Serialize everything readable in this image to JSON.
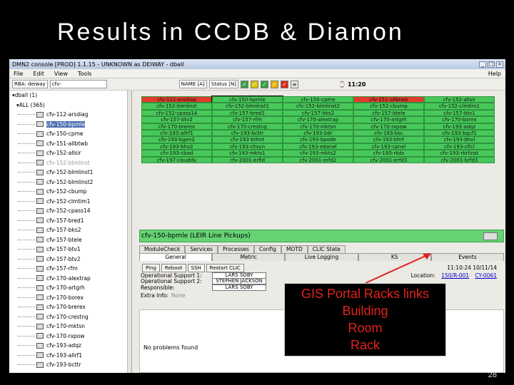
{
  "slide": {
    "title": "Results in CCDB & Diamon",
    "page_number": "28"
  },
  "window": {
    "title": "DMN2 console [PROD] 1.1.15 - UNKNOWN as DEIWAY - dball",
    "menu": [
      "File",
      "Edit",
      "View",
      "Tools"
    ],
    "help": "Help",
    "toolbar": {
      "rba_label": "RBA: deiway",
      "filter_value": "cfv-",
      "name_field": "NAME [A]",
      "status_field": "Status [N]",
      "time": "11:20"
    }
  },
  "tree": {
    "root": "dball (1)",
    "group": "ALL (365)",
    "selected_index": 1,
    "items": [
      {
        "label": "cfv-112-arsdiag",
        "dim": false
      },
      {
        "label": "cfv-150-bpmle",
        "dim": false
      },
      {
        "label": "cfv-150-cpme",
        "dim": false
      },
      {
        "label": "cfv-151-allbtwb",
        "dim": false
      },
      {
        "label": "cfv-152-allsir",
        "dim": false
      },
      {
        "label": "cfv-152-blmlinst",
        "dim": true
      },
      {
        "label": "cfv-152-blmlinst1",
        "dim": false
      },
      {
        "label": "cfv-152-blmlinst2",
        "dim": false
      },
      {
        "label": "cfv-152-cbump",
        "dim": false
      },
      {
        "label": "cfv-152-clmtim1",
        "dim": false
      },
      {
        "label": "cfv-152-cpass14",
        "dim": false
      },
      {
        "label": "cfv-157-bred1",
        "dim": false
      },
      {
        "label": "cfv-157-bks2",
        "dim": false
      },
      {
        "label": "cfv-157-btele",
        "dim": false
      },
      {
        "label": "cfv-157-btv1",
        "dim": false
      },
      {
        "label": "cfv-157-btv2",
        "dim": false
      },
      {
        "label": "cfv-157-rfm",
        "dim": false
      },
      {
        "label": "cfv-170-alextrap",
        "dim": false
      },
      {
        "label": "cfv-170-artgrh",
        "dim": false
      },
      {
        "label": "cfv-170-borex",
        "dim": false
      },
      {
        "label": "cfv-170-brerex",
        "dim": false
      },
      {
        "label": "cfv-170-crestng",
        "dim": false
      },
      {
        "label": "cfv-170-mktsn",
        "dim": false
      },
      {
        "label": "cfv-170-rxpow",
        "dim": false
      },
      {
        "label": "cfv-193-adqz",
        "dim": false
      },
      {
        "label": "cfv-193-allrf1",
        "dim": false
      },
      {
        "label": "cfv-193-bcttr",
        "dim": false
      }
    ]
  },
  "grid": {
    "rows": [
      [
        {
          "t": "cfv-112-arsdiag",
          "s": "red"
        },
        {
          "t": "cfv-150-bpmle",
          "s": "sel"
        },
        {
          "t": "cfv-150-cpme",
          "s": "ok"
        },
        {
          "t": "cfv-151-allbtwb",
          "s": "red"
        },
        {
          "t": "cfv-152-allsir",
          "s": "ok"
        }
      ],
      [
        {
          "t": "cfv-152-blmlinst",
          "s": "ok"
        },
        {
          "t": "cfv-152-blmlinst1",
          "s": "ok"
        },
        {
          "t": "cfv-152-blmlinst2",
          "s": "ok"
        },
        {
          "t": "cfv-152-cbump",
          "s": "ok"
        },
        {
          "t": "cfv-152-clmtim1",
          "s": "ok"
        }
      ],
      [
        {
          "t": "cfv-152-cpass14",
          "s": "ok"
        },
        {
          "t": "cfv-157-bred1",
          "s": "ok"
        },
        {
          "t": "cfv-157-bks2",
          "s": "ok"
        },
        {
          "t": "cfv-157-btele",
          "s": "ok"
        },
        {
          "t": "cfv-157-btv1",
          "s": "ok"
        }
      ],
      [
        {
          "t": "cfv-157-btv2",
          "s": "ok"
        },
        {
          "t": "cfv-157-rfm",
          "s": "ok"
        },
        {
          "t": "cfv-170-alextrap",
          "s": "ok"
        },
        {
          "t": "cfv-170-artgrh",
          "s": "ok"
        },
        {
          "t": "cfv-170-borex",
          "s": "ok"
        }
      ],
      [
        {
          "t": "cfv-170-brerex",
          "s": "ok"
        },
        {
          "t": "cfv-170-crestng",
          "s": "ok"
        },
        {
          "t": "cfv-170-mktsn",
          "s": "ok"
        },
        {
          "t": "cfv-170-rxpow",
          "s": "ok"
        },
        {
          "t": "cfv-193-adqz",
          "s": "ok"
        }
      ],
      [
        {
          "t": "cfv-193-allrf1",
          "s": "ok"
        },
        {
          "t": "cfv-193-bcttr",
          "s": "ok"
        },
        {
          "t": "cfv-193-bdr",
          "s": "ok"
        },
        {
          "t": "cfv-193-bsc",
          "s": "ok"
        },
        {
          "t": "cfv-193-bgcf1",
          "s": "ok"
        }
      ],
      [
        {
          "t": "cfv-193-bgen2",
          "s": "ok"
        },
        {
          "t": "cfv-193-bthnt",
          "s": "ok"
        },
        {
          "t": "cfv-193-bpode",
          "s": "ok"
        },
        {
          "t": "cfv-193-bhrf",
          "s": "ok"
        },
        {
          "t": "cfv-193-bhvl",
          "s": "ok"
        }
      ],
      [
        {
          "t": "cfv-193-bhv2",
          "s": "ok"
        },
        {
          "t": "cfv-193-chsyn",
          "s": "ok"
        },
        {
          "t": "cfv-193-edanel",
          "s": "ok"
        },
        {
          "t": "cfv-193-cpnel",
          "s": "ok"
        },
        {
          "t": "cfv-193-cficl",
          "s": "ok"
        }
      ],
      [
        {
          "t": "cfv-193-cbad",
          "s": "ok"
        },
        {
          "t": "cfv-193-mkts1",
          "s": "ok"
        },
        {
          "t": "cfv-193-mkts2",
          "s": "ok"
        },
        {
          "t": "cfv-193-rkds",
          "s": "ok"
        },
        {
          "t": "cfv-193-rbrlinst",
          "s": "ok"
        }
      ],
      [
        {
          "t": "cfv-197-cisuddy",
          "s": "ok"
        },
        {
          "t": "cfv-2001-erfid",
          "s": "ok"
        },
        {
          "t": "cfv-2001-erfd2",
          "s": "ok"
        },
        {
          "t": "cfv-2001-erfd3",
          "s": "ok"
        },
        {
          "t": "cfv-2001-brfd3",
          "s": "ok"
        }
      ]
    ]
  },
  "info": {
    "header": "cfv-150-bpmle (LEIR Line Pickups)",
    "tabs_top": [
      "ModuleCheck",
      "Services",
      "Processes",
      "Config",
      "MOTD",
      "CLIC State"
    ],
    "tabs_sub": [
      "General",
      "Metric",
      "Live Logging",
      "KS",
      "Events"
    ],
    "buttons": [
      "Ping",
      "Reboot",
      "SSH",
      "Restart CLIC"
    ],
    "timestamp": "11:10:24 10/11/14",
    "location_label": "Location:",
    "location_link1": "150/R-001",
    "location_link2": "CY-0061",
    "fields": [
      {
        "label": "Operational Support 1:",
        "value": "LARS SOBY"
      },
      {
        "label": "Operational Support 2:",
        "value": "STEPHEN JACKSON"
      },
      {
        "label": "Responsible:",
        "value": "LARS SOBY"
      }
    ],
    "extra_label": "Extra Info:",
    "extra_value": "None",
    "status_text": "No problems found"
  },
  "callout": {
    "lines": [
      "GIS Portal Racks links",
      "Building",
      "Room",
      "Rack"
    ],
    "color": "#e0231b"
  }
}
